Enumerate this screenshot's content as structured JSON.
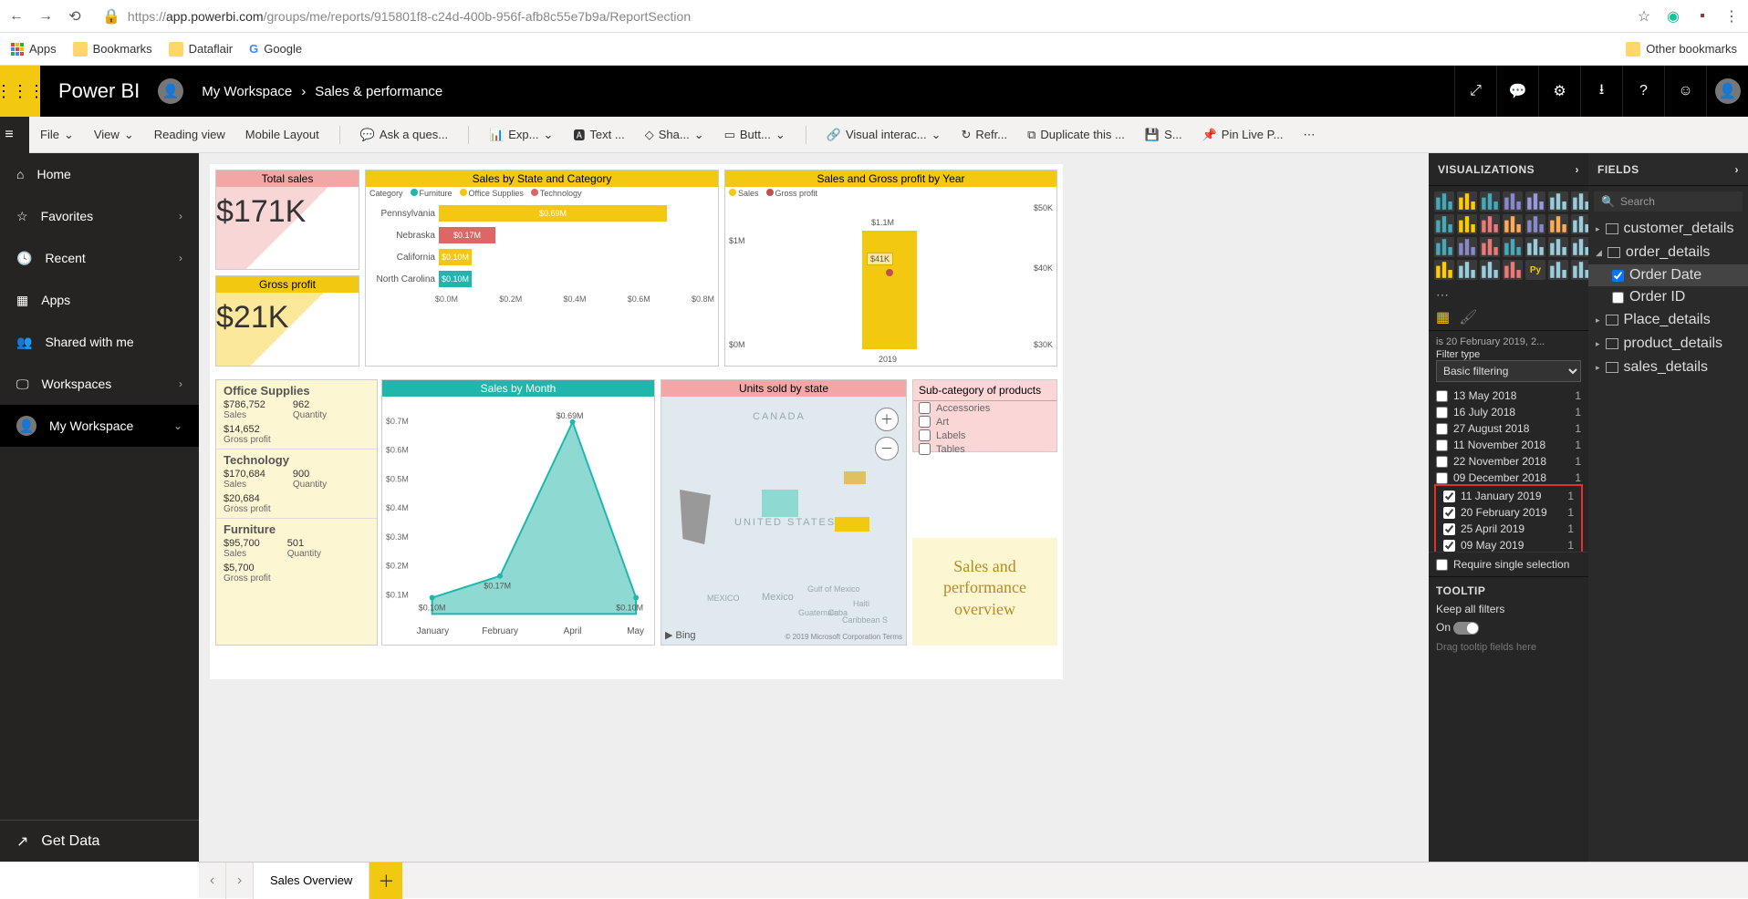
{
  "browser": {
    "url_prefix": "https://",
    "url_host": "app.powerbi.com",
    "url_path": "/groups/me/reports/915801f8-c24d-400b-956f-afb8c55e7b9a/ReportSection",
    "bookmarks": [
      "Bookmarks",
      "Dataflair",
      "Google"
    ],
    "apps_label": "Apps",
    "other_bookmarks": "Other bookmarks"
  },
  "appbar": {
    "product": "Power BI",
    "workspace": "My Workspace",
    "report": "Sales & performance"
  },
  "ribbon": {
    "file": "File",
    "view": "View",
    "reading": "Reading view",
    "mobile": "Mobile Layout",
    "ask": "Ask a ques...",
    "explore": "Exp...",
    "text": "Text ...",
    "shapes": "Sha...",
    "buttons": "Butt...",
    "visual_inter": "Visual interac...",
    "refresh": "Refr...",
    "duplicate": "Duplicate this ...",
    "save": "S...",
    "pin": "Pin Live P..."
  },
  "nav": {
    "items": [
      "Home",
      "Favorites",
      "Recent",
      "Apps",
      "Shared with me",
      "Workspaces",
      "My Workspace"
    ],
    "get_data": "Get Data"
  },
  "cards": {
    "total_sales": {
      "title": "Total sales",
      "value": "$171K",
      "color": "#f2a6a6"
    },
    "gross_profit": {
      "title": "Gross profit",
      "value": "$21K",
      "color": "#f2c811"
    },
    "sales_state": {
      "title": "Sales by State and Category",
      "legend_label": "Category",
      "series": [
        "Furniture",
        "Office Supplies",
        "Technology"
      ],
      "colors": [
        "#1fb6ad",
        "#f2c811",
        "#e06666"
      ]
    },
    "sales_year": {
      "title": "Sales and Gross profit by Year",
      "series": [
        "Sales",
        "Gross profit"
      ],
      "colors": [
        "#f2c811",
        "#c0504d"
      ]
    },
    "sales_month": {
      "title": "Sales by Month"
    },
    "units_map": {
      "title": "Units sold by state",
      "bing": "Bing",
      "credit": "© 2019 Microsoft Corporation Terms"
    },
    "subcat": {
      "title": "Sub-category of products",
      "items": [
        "Accessories",
        "Art",
        "Labels",
        "Tables"
      ]
    },
    "overview": "Sales and performance overview",
    "kpi_block": {
      "groups": [
        {
          "name": "Office Supplies",
          "sales": "$786,752",
          "qty": "962",
          "gp": "$14,652"
        },
        {
          "name": "Technology",
          "sales": "$170,684",
          "qty": "900",
          "gp": "$20,684"
        },
        {
          "name": "Furniture",
          "sales": "$95,700",
          "qty": "501",
          "gp": "$5,700"
        }
      ],
      "labels": {
        "sales": "Sales",
        "qty": "Quantity",
        "gp": "Gross profit"
      }
    }
  },
  "chart_data": {
    "sales_by_state_category": {
      "type": "bar",
      "xlabel": "",
      "ylabel": "",
      "categories": [
        "Pennsylvania",
        "Nebraska",
        "California",
        "North Carolina"
      ],
      "stacked_values": [
        {
          "Furniture": 0.02,
          "Office Supplies": 0.62,
          "Technology": 0.05,
          "label": "$0.69M"
        },
        {
          "Furniture": 0.17,
          "label": "$0.17M",
          "color": "#e06666"
        },
        {
          "Furniture": 0.1,
          "label": "$0.10M",
          "color": "#f2c811"
        },
        {
          "Furniture": 0.1,
          "label": "$0.10M",
          "color": "#1fb6ad"
        }
      ],
      "x_ticks": [
        "$0.0M",
        "$0.2M",
        "$0.4M",
        "$0.6M",
        "$0.8M"
      ]
    },
    "sales_gross_profit_year": {
      "type": "bar+line",
      "categories": [
        "2019"
      ],
      "bar_values": [
        1.1
      ],
      "bar_label": "$1.1M",
      "line_values": [
        41
      ],
      "line_label": "$41K",
      "y_left": [
        "$0M",
        "$1M"
      ],
      "y_right": [
        "$30K",
        "$40K",
        "$50K"
      ]
    },
    "sales_by_month": {
      "type": "area",
      "categories": [
        "January",
        "February",
        "April",
        "May"
      ],
      "values": [
        0.1,
        0.17,
        0.69,
        0.1
      ],
      "labels": [
        "$0.10M",
        "$0.17M",
        "$0.69M",
        "$0.10M"
      ],
      "y_ticks": [
        "$0.1M",
        "$0.2M",
        "$0.3M",
        "$0.4M",
        "$0.5M",
        "$0.6M",
        "$0.7M"
      ]
    }
  },
  "viz_pane": {
    "title": "VISUALIZATIONS",
    "filter_summary": "is 20 February 2019, 2...",
    "filter_type_label": "Filter type",
    "filter_type": "Basic filtering",
    "filter_items": [
      {
        "label": "13 May 2018",
        "count": "1",
        "checked": false
      },
      {
        "label": "16 July 2018",
        "count": "1",
        "checked": false
      },
      {
        "label": "27 August 2018",
        "count": "1",
        "checked": false
      },
      {
        "label": "11 November 2018",
        "count": "1",
        "checked": false
      },
      {
        "label": "22 November 2018",
        "count": "1",
        "checked": false
      },
      {
        "label": "09 December 2018",
        "count": "1",
        "checked": false
      },
      {
        "label": "11 January 2019",
        "count": "1",
        "checked": true
      },
      {
        "label": "20 February 2019",
        "count": "1",
        "checked": true
      },
      {
        "label": "25 April 2019",
        "count": "1",
        "checked": true
      },
      {
        "label": "09 May 2019",
        "count": "1",
        "checked": true
      }
    ],
    "require_single": "Require single selection",
    "tooltip_hdr": "TOOLTIP",
    "keep_filters": "Keep all filters",
    "on": "On",
    "drag_hint": "Drag tooltip fields here"
  },
  "fields_pane": {
    "title": "FIELDS",
    "search": "Search",
    "tables": [
      {
        "name": "customer_details",
        "expanded": false
      },
      {
        "name": "order_details",
        "expanded": true,
        "fields": [
          "Order Date",
          "Order ID"
        ],
        "selected": "Order Date"
      },
      {
        "name": "Place_details",
        "expanded": false
      },
      {
        "name": "product_details",
        "expanded": false
      },
      {
        "name": "sales_details",
        "expanded": false
      }
    ]
  },
  "tabs": {
    "active": "Sales Overview"
  }
}
